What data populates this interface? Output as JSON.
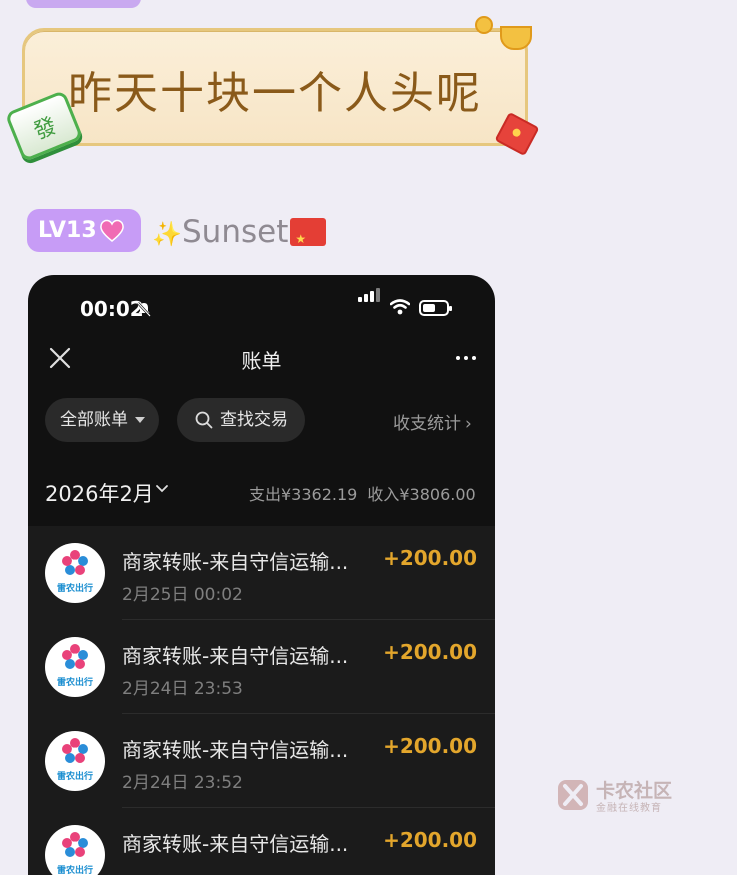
{
  "sticker": {
    "text": "昨天十块一个人头呢"
  },
  "user": {
    "level": "LV13",
    "name": "Sunset"
  },
  "phone": {
    "status": {
      "time": "00:02"
    },
    "nav": {
      "title": "账单"
    },
    "filters": {
      "all_bills": "全部账单",
      "search": "查找交易",
      "stats": "收支统计"
    },
    "period": {
      "month": "2026年2月",
      "expense": "支出¥3362.19",
      "income": "收入¥3806.00"
    },
    "brand_label": "雷农出行",
    "transactions": [
      {
        "title": "商家转账-来自守信运输...",
        "date": "2月25日 00:02",
        "amount": "+200.00"
      },
      {
        "title": "商家转账-来自守信运输...",
        "date": "2月24日 23:53",
        "amount": "+200.00"
      },
      {
        "title": "商家转账-来自守信运输...",
        "date": "2月24日 23:52",
        "amount": "+200.00"
      },
      {
        "title": "商家转账-来自守信运输...",
        "date": "",
        "amount": "+200.00"
      }
    ]
  },
  "watermark": {
    "name": "卡农社区",
    "subtitle": "金融在线教育"
  },
  "colors": {
    "amount": "#e3a62c",
    "badge": "#c79cf6",
    "phone_bg": "#111111"
  }
}
